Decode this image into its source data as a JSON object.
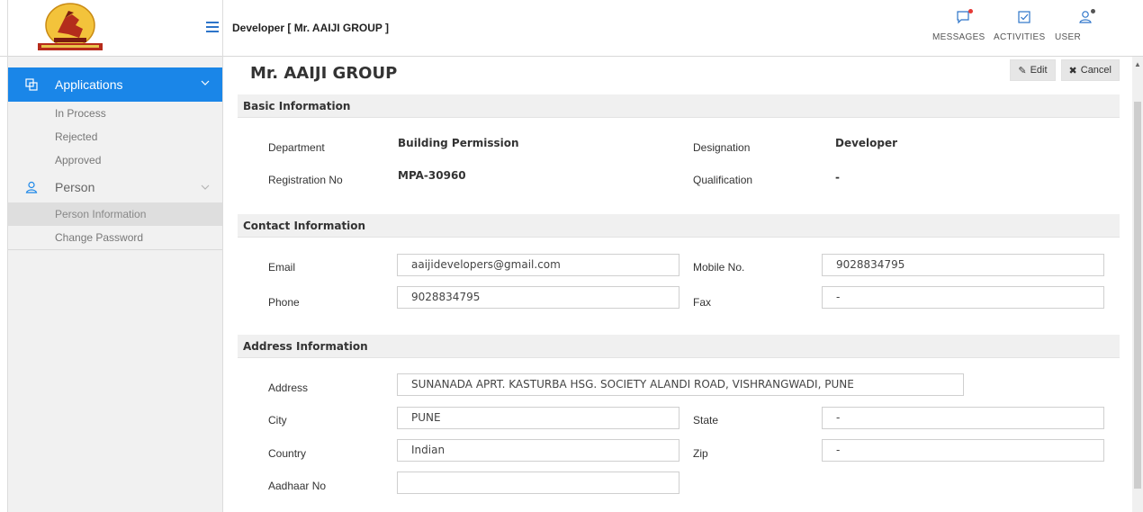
{
  "header": {
    "title": "Developer [ Mr. AAIJI GROUP ]",
    "actions": [
      {
        "label": "MESSAGES",
        "icon": "message-icon"
      },
      {
        "label": "ACTIVITIES",
        "icon": "checkbox-icon"
      },
      {
        "label": "USER",
        "icon": "user-icon"
      }
    ],
    "accent": "#1a86e8",
    "notify_color": "#e53935"
  },
  "sidebar": {
    "sections": [
      {
        "label": "Applications",
        "icon": "applications-icon",
        "active": true,
        "items": [
          "In Process",
          "Rejected",
          "Approved"
        ]
      },
      {
        "label": "Person",
        "icon": "person-icon",
        "active": false,
        "items": [
          "Person Information",
          "Change Password"
        ],
        "selected": "Person Information"
      }
    ]
  },
  "page": {
    "title": "Mr. AAIJI GROUP",
    "edit_label": "Edit",
    "cancel_label": "Cancel"
  },
  "basic": {
    "heading": "Basic Information",
    "department_label": "Department",
    "department_value": "Building Permission",
    "designation_label": "Designation",
    "designation_value": "Developer",
    "registration_label": "Registration No",
    "registration_value": "MPA-30960",
    "qualification_label": "Qualification",
    "qualification_value": "-"
  },
  "contact": {
    "heading": "Contact Information",
    "email_label": "Email",
    "email_value": "aaijidevelopers@gmail.com",
    "mobile_label": "Mobile No.",
    "mobile_value": "9028834795",
    "phone_label": "Phone",
    "phone_value": "9028834795",
    "fax_label": "Fax",
    "fax_value": "-"
  },
  "address": {
    "heading": "Address Information",
    "address_label": "Address",
    "address_value": "SUNANADA APRT. KASTURBA HSG. SOCIETY ALANDI ROAD, VISHRANGWADI, PUNE",
    "city_label": "City",
    "city_value": "PUNE",
    "state_label": "State",
    "state_value": "-",
    "country_label": "Country",
    "country_value": "Indian",
    "zip_label": "Zip",
    "zip_value": "-",
    "aadhaar_label": "Aadhaar No",
    "aadhaar_value": ""
  }
}
